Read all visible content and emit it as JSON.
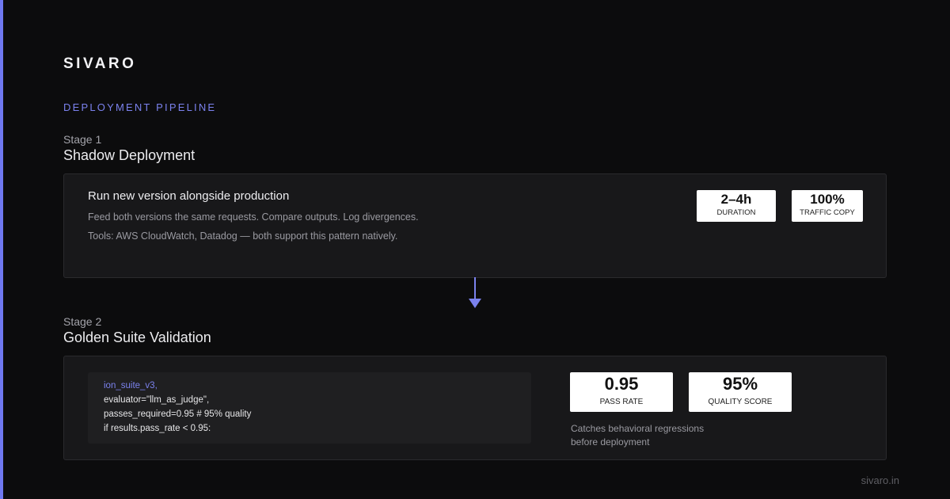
{
  "brand": "SIVARO",
  "section_label": "DEPLOYMENT PIPELINE",
  "stage1": {
    "number": "Stage 1",
    "title": "Shadow Deployment",
    "heading": "Run new version alongside production",
    "line1": "Feed both versions the same requests. Compare outputs. Log divergences.",
    "line2": "Tools: AWS CloudWatch, Datadog — both support this pattern natively.",
    "stats": [
      {
        "value": "2–4h",
        "label": "Duration"
      },
      {
        "value": "100%",
        "label": "Traffic Copy"
      }
    ]
  },
  "stage2": {
    "number": "Stage 2",
    "title": "Golden Suite Validation",
    "code_lines": [
      "ion_suite_v3,",
      "evaluator=\"llm_as_judge\",",
      "passes_required=0.95 # 95% quality",
      "if results.pass_rate < 0.95:"
    ],
    "stats": [
      {
        "value": "0.95",
        "label": "Pass Rate"
      },
      {
        "value": "95%",
        "label": "Quality Score"
      }
    ],
    "note_line1": "Catches behavioral regressions",
    "note_line2": "before deployment"
  },
  "footer": "sivaro.in",
  "colors": {
    "accent": "#6f78f0",
    "background": "#0c0c0d",
    "card": "#18181a"
  }
}
